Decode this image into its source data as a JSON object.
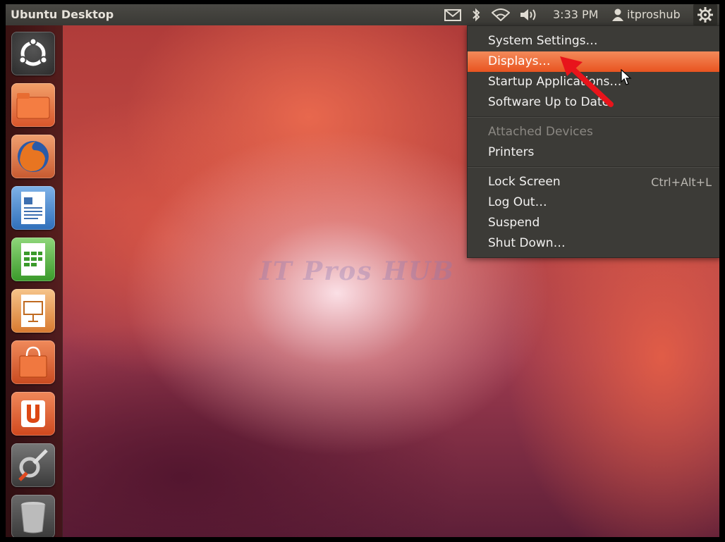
{
  "panel": {
    "title": "Ubuntu Desktop",
    "time": "3:33 PM",
    "user": "itproshub"
  },
  "tray_icons": [
    "mail-icon",
    "bluetooth-icon",
    "wifi-icon",
    "volume-icon",
    "user-icon",
    "gear-icon"
  ],
  "launcher": {
    "items": [
      {
        "name": "dash-home",
        "icon": "ubuntu-logo-icon"
      },
      {
        "name": "home-folder",
        "icon": "folder-icon"
      },
      {
        "name": "firefox",
        "icon": "firefox-icon"
      },
      {
        "name": "libreoffice-writer",
        "icon": "writer-icon"
      },
      {
        "name": "libreoffice-calc",
        "icon": "calc-icon"
      },
      {
        "name": "libreoffice-impress",
        "icon": "impress-icon"
      },
      {
        "name": "ubuntu-software-center",
        "icon": "shopping-bag-icon"
      },
      {
        "name": "ubuntu-one",
        "icon": "ubuntu-one-icon"
      },
      {
        "name": "system-settings",
        "icon": "settings-icon"
      },
      {
        "name": "trash",
        "icon": "trash-icon"
      }
    ]
  },
  "menu": {
    "items": [
      {
        "label": "System Settings…",
        "state": "normal"
      },
      {
        "label": "Displays…",
        "state": "highlight"
      },
      {
        "label": "Startup Applications…",
        "state": "normal"
      },
      {
        "label": "Software Up to Date",
        "state": "normal"
      },
      {
        "label": "Attached Devices",
        "state": "disabled"
      },
      {
        "label": "Printers",
        "state": "normal"
      },
      {
        "label": "Lock Screen",
        "shortcut": "Ctrl+Alt+L",
        "state": "normal"
      },
      {
        "label": "Log Out…",
        "state": "normal"
      },
      {
        "label": "Suspend",
        "state": "normal"
      },
      {
        "label": "Shut Down…",
        "state": "normal"
      }
    ]
  },
  "watermark": "IT Pros HUB",
  "colors": {
    "accent": "#e95420",
    "panel": "#3c3b37",
    "arrow": "#e8141b"
  }
}
